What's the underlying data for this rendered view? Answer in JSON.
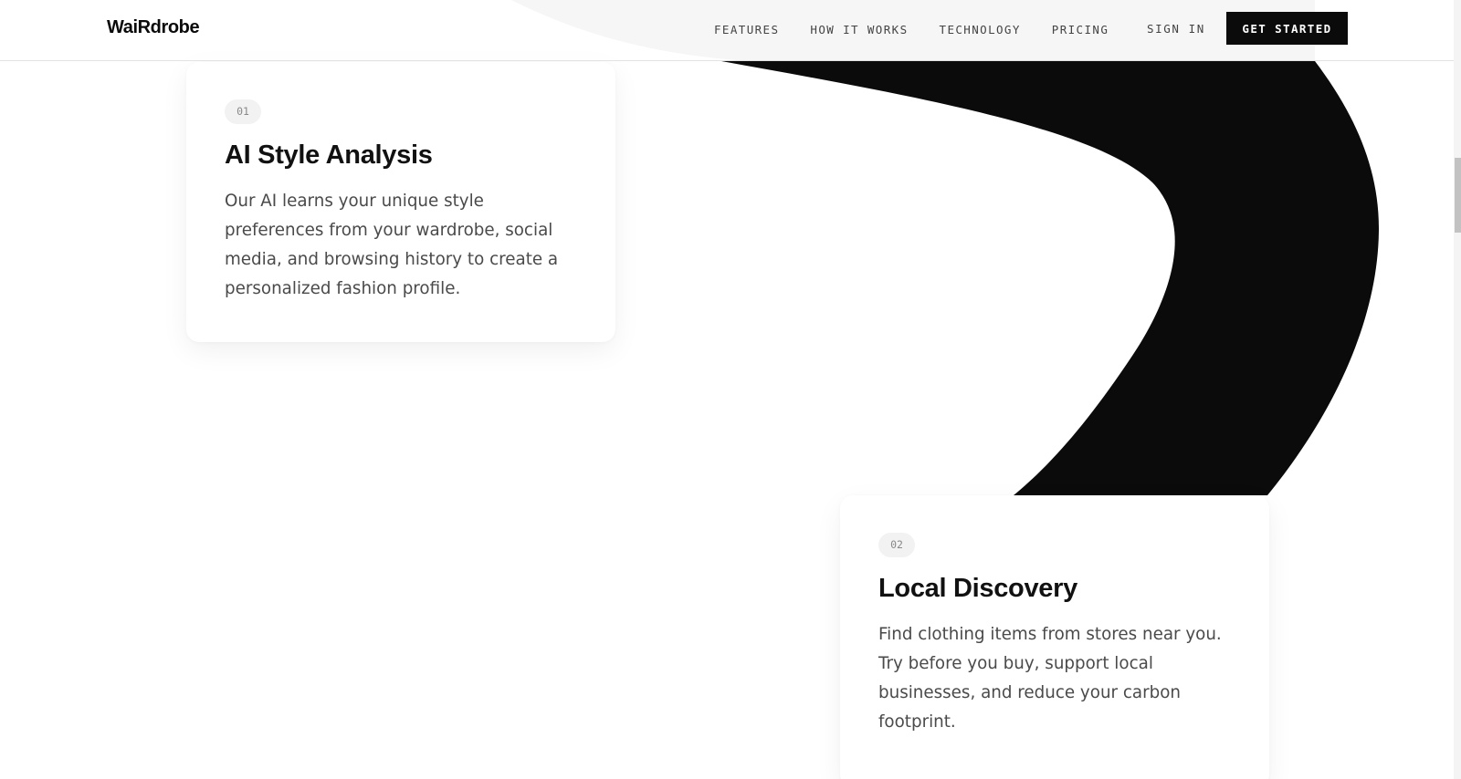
{
  "brand": {
    "name": "WaiRdrobe"
  },
  "nav": {
    "links": [
      {
        "label": "FEATURES"
      },
      {
        "label": "HOW IT WORKS"
      },
      {
        "label": "TECHNOLOGY"
      },
      {
        "label": "PRICING"
      }
    ],
    "sign_in": "SIGN IN",
    "cta": "GET STARTED"
  },
  "features": [
    {
      "number": "01",
      "title": "AI Style Analysis",
      "description": "Our AI learns your unique style preferences from your wardrobe, social media, and browsing history to create a personalized fashion profile."
    },
    {
      "number": "02",
      "title": "Local Discovery",
      "description": "Find clothing items from stores near you. Try before you buy, support local businesses, and reduce your carbon footprint."
    }
  ],
  "colors": {
    "primary": "#0b0b0b",
    "background": "#ffffff",
    "text_muted": "#4a4a4a",
    "badge_bg": "#f2f2f2"
  }
}
